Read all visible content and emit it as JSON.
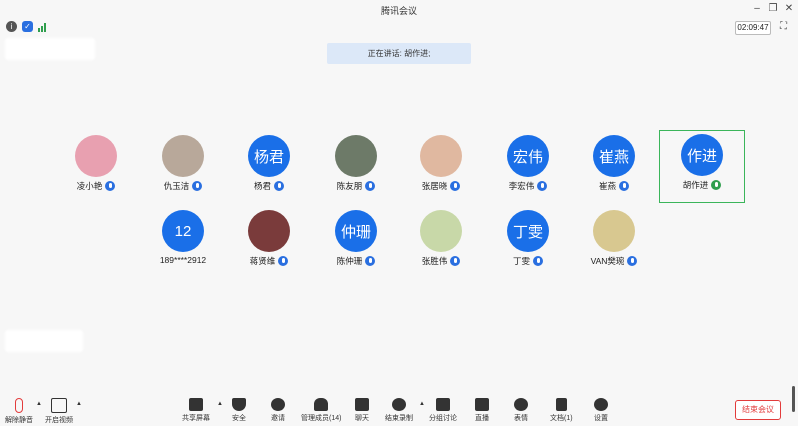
{
  "window": {
    "title": "腾讯会议",
    "timer": "02:09:47"
  },
  "speaker_banner": "正在讲话: 胡作进;",
  "participants_row1": [
    {
      "name": "凌小艳",
      "avatar_text": "",
      "avatar_color": "#e8a0b0"
    },
    {
      "name": "仇玉洁",
      "avatar_text": "",
      "avatar_color": "#b8a89a"
    },
    {
      "name": "杨君",
      "avatar_text": "杨君",
      "avatar_color": "#1a6fe8"
    },
    {
      "name": "陈友朋",
      "avatar_text": "",
      "avatar_color": "#6d7a68"
    },
    {
      "name": "张居晓",
      "avatar_text": "",
      "avatar_color": "#e0b8a0"
    },
    {
      "name": "李宏伟",
      "avatar_text": "宏伟",
      "avatar_color": "#1a6fe8"
    },
    {
      "name": "崔燕",
      "avatar_text": "崔燕",
      "avatar_color": "#1a6fe8"
    },
    {
      "name": "胡作进",
      "avatar_text": "作进",
      "avatar_color": "#1a6fe8"
    }
  ],
  "participants_row2": [
    {
      "name": "189****2912",
      "avatar_text": "12",
      "avatar_color": "#1a6fe8"
    },
    {
      "name": "蒋贤维",
      "avatar_text": "",
      "avatar_color": "#7a3b3b"
    },
    {
      "name": "陈仲珊",
      "avatar_text": "仲珊",
      "avatar_color": "#1a6fe8"
    },
    {
      "name": "张胜伟",
      "avatar_text": "",
      "avatar_color": "#c8d8a8"
    },
    {
      "name": "丁雯",
      "avatar_text": "丁雯",
      "avatar_color": "#1a6fe8"
    },
    {
      "name": "VAN樊琬",
      "avatar_text": "",
      "avatar_color": "#d8c890"
    }
  ],
  "toolbar": {
    "unmute": "解除静音",
    "start_video": "开启视频",
    "share_screen": "共享屏幕",
    "security": "安全",
    "invite": "邀请",
    "manage_members": "管理成员(14)",
    "chat": "聊天",
    "end_recording": "结束录制",
    "breakout": "分组讨论",
    "live": "直播",
    "reactions": "表情",
    "documents": "文档(1)",
    "settings": "设置",
    "end_meeting": "结束会议"
  }
}
